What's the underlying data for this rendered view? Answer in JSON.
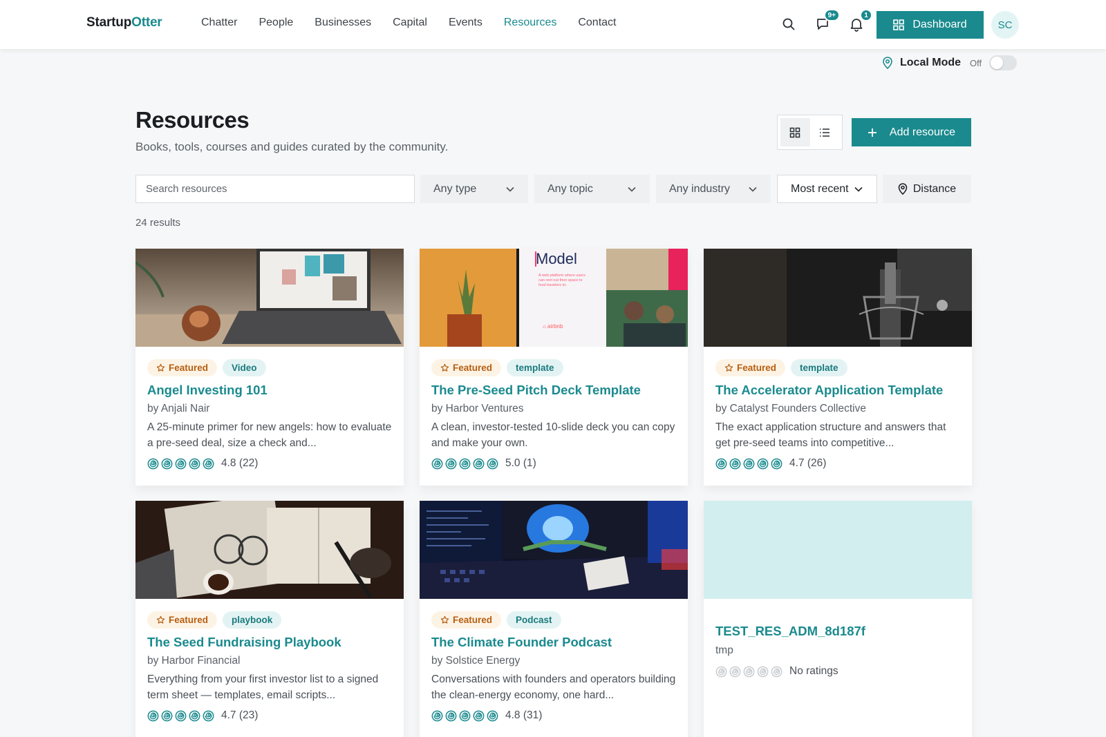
{
  "brand": {
    "name_part1": "Startup",
    "name_part2": "Otter"
  },
  "nav": {
    "items": [
      "Chatter",
      "People",
      "Businesses",
      "Capital",
      "Events",
      "Resources",
      "Contact"
    ],
    "active_index": 5
  },
  "header": {
    "messages_badge": "9+",
    "notifications_badge": "1",
    "dashboard_label": "Dashboard",
    "avatar_initials": "SC"
  },
  "local_mode": {
    "label": "Local Mode",
    "state": "Off",
    "enabled": false
  },
  "page": {
    "title": "Resources",
    "subtitle": "Books, tools, courses and guides curated by the community.",
    "add_label": "Add resource",
    "view_mode": "grid"
  },
  "filters": {
    "search_placeholder": "Search resources",
    "type": "Any type",
    "topic": "Any topic",
    "industry": "Any industry",
    "sort": "Most recent",
    "distance_label": "Distance"
  },
  "results_label": "24 results",
  "colors": {
    "accent": "#1a8a8e",
    "featured_bg": "#fdf3e5",
    "featured_text": "#b65e10",
    "type_bg": "#e3f3f3"
  },
  "cards": [
    {
      "featured": "Featured",
      "type": "Video",
      "title": "Angel Investing 101",
      "by": "by Anjali Nair",
      "desc": "A 25-minute primer for new angels: how to evaluate a pre-seed deal, size a check and...",
      "rating": 4.8,
      "rating_text": "4.8 (22)"
    },
    {
      "featured": "Featured",
      "type": "template",
      "title": "The Pre-Seed Pitch Deck Template",
      "by": "by Harbor Ventures",
      "desc": "A clean, investor-tested 10-slide deck you can copy and make your own.",
      "rating": 5.0,
      "rating_text": "5.0 (1)",
      "image_text": {
        "heading": "Model",
        "caption": "A web platform where users can rent out their space to host travelers to:",
        "brand": "airbnb"
      }
    },
    {
      "featured": "Featured",
      "type": "template",
      "title": "The Accelerator Application Template",
      "by": "by Catalyst Founders Collective",
      "desc": "The exact application structure and answers that get pre-seed teams into competitive...",
      "rating": 4.7,
      "rating_text": "4.7 (26)"
    },
    {
      "featured": "Featured",
      "type": "playbook",
      "title": "The Seed Fundraising Playbook",
      "by": "by Harbor Financial",
      "desc": "Everything from your first investor list to a signed term sheet — templates, email scripts...",
      "rating": 4.7,
      "rating_text": "4.7 (23)"
    },
    {
      "featured": "Featured",
      "type": "Podcast",
      "title": "The Climate Founder Podcast",
      "by": "by Solstice Energy",
      "desc": "Conversations with founders and operators building the clean-energy economy, one hard...",
      "rating": 4.8,
      "rating_text": "4.8 (31)"
    },
    {
      "featured": "",
      "type": "",
      "title": "TEST_RES_ADM_8d187f",
      "by": "tmp",
      "desc": "",
      "rating": 0,
      "rating_text": "No ratings"
    }
  ]
}
